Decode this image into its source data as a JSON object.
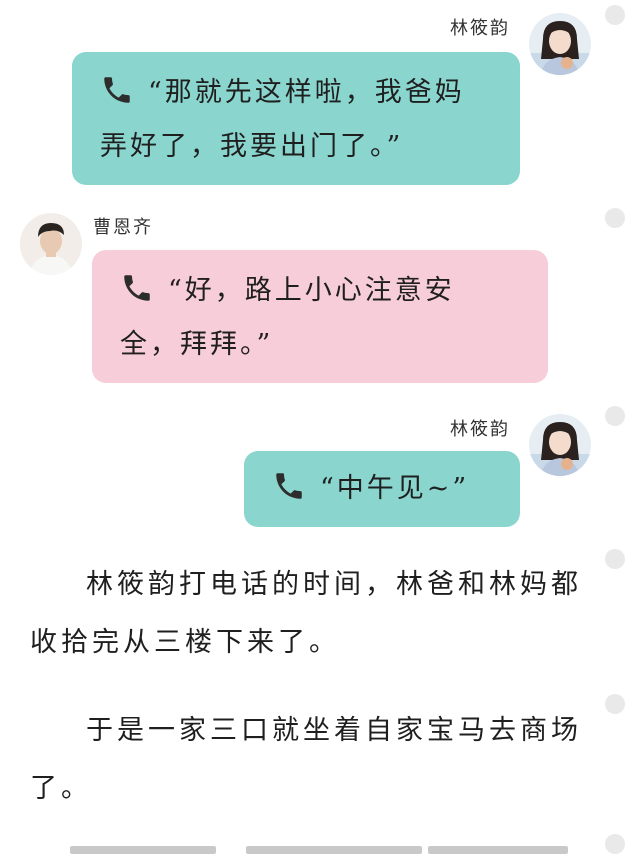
{
  "messages": [
    {
      "sender": "林筱韵",
      "side": "right",
      "text_line1": "“那就先这样啦，我爸妈",
      "text_line2": "弄好了，我要出门了。”",
      "bubble_color": "#8ad6cf",
      "icon": "phone-icon"
    },
    {
      "sender": "曹恩齐",
      "side": "left",
      "text_line1": "“好，路上小心注意安",
      "text_line2": "全，拜拜。”",
      "bubble_color": "#f7cdd9",
      "icon": "phone-icon"
    },
    {
      "sender": "林筱韵",
      "side": "right",
      "text_line1": "“中午见~”",
      "bubble_color": "#8ad6cf",
      "icon": "phone-icon"
    }
  ],
  "narration": [
    {
      "line1": "林筱韵打电话的时间，林爸和林妈都",
      "line2": "收拾完从三楼下来了。"
    },
    {
      "line1": "于是一家三口就坐着自家宝马去商场",
      "line2": "了。"
    }
  ],
  "colors": {
    "teal_bubble": "#8ad6cf",
    "pink_bubble": "#f7cdd9",
    "scroll_dot": "#e9e9e9"
  }
}
